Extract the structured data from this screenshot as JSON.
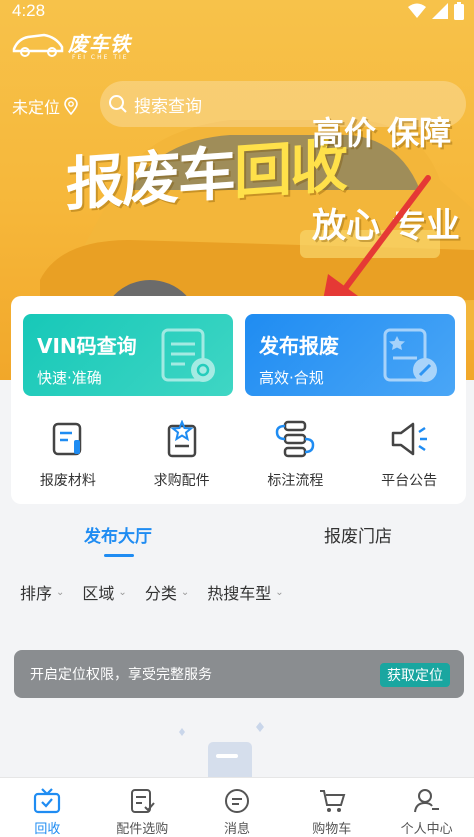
{
  "status": {
    "time": "4:28"
  },
  "brand": {
    "name": "废车铁",
    "sub": "FEI CHE TIE"
  },
  "header": {
    "location": "未定位",
    "search_placeholder": "搜索查询"
  },
  "banner": {
    "main_a": "报废车",
    "main_b": "回收",
    "tag1": "高价 保障",
    "tag2": "放心 专业"
  },
  "features": [
    {
      "title": "VIN码查询",
      "subtitle": "快速·准确"
    },
    {
      "title": "发布报废",
      "subtitle": "高效·合规"
    }
  ],
  "menu": [
    {
      "label": "报废材料",
      "icon": "document-icon"
    },
    {
      "label": "求购配件",
      "icon": "clipboard-star-icon"
    },
    {
      "label": "标注流程",
      "icon": "flow-icon"
    },
    {
      "label": "平台公告",
      "icon": "megaphone-icon"
    }
  ],
  "tabs": {
    "active": "发布大厅",
    "inactive": "报废门店"
  },
  "filters": [
    "排序",
    "区域",
    "分类",
    "热搜车型"
  ],
  "notice": {
    "text": "开启定位权限，享受完整服务",
    "button": "获取定位"
  },
  "tabbar": [
    {
      "label": "回收",
      "icon": "recycle-tv-icon"
    },
    {
      "label": "配件选购",
      "icon": "parts-list-icon"
    },
    {
      "label": "消息",
      "icon": "message-icon"
    },
    {
      "label": "购物车",
      "icon": "cart-icon"
    },
    {
      "label": "个人中心",
      "icon": "user-icon"
    }
  ],
  "colors": {
    "primary": "#1f8cf2",
    "teal": "#17c8b8",
    "banner": "#f6b73a"
  }
}
